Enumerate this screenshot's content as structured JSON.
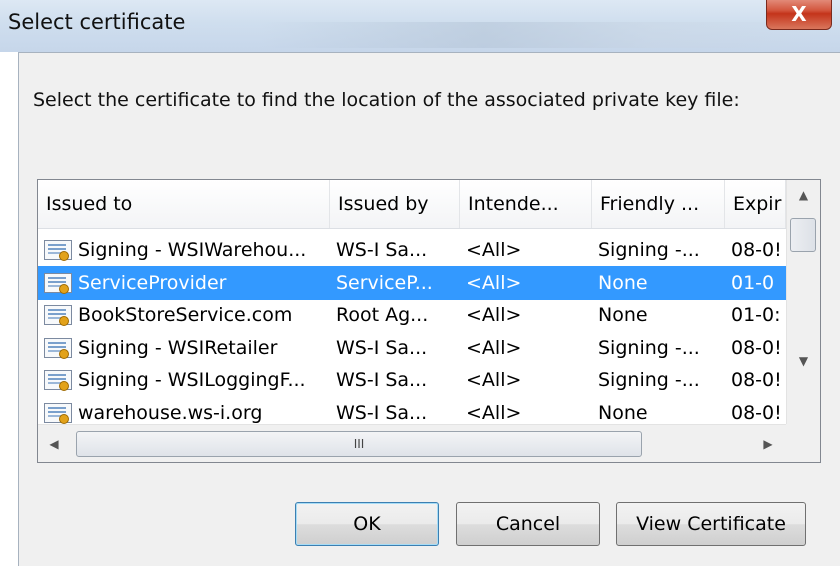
{
  "window": {
    "title": "Select certificate",
    "close_glyph": "X"
  },
  "prompt": "Select the certificate to find the location of the associated private key file:",
  "list": {
    "columns": [
      "Issued to",
      "Issued by",
      "Intende...",
      "Friendly ...",
      "Expir"
    ],
    "rows": [
      {
        "issued_to": "Signing - WSIWarehou...",
        "issued_by": "WS-I Sa...",
        "intended": "<All>",
        "friendly": "Signing -...",
        "expiry": "08-0!",
        "icon": "certificate-icon",
        "selected": false
      },
      {
        "issued_to": "ServiceProvider",
        "issued_by": "ServiceP...",
        "intended": "<All>",
        "friendly": "None",
        "expiry": "01-0",
        "icon": "certificate-icon",
        "selected": true
      },
      {
        "issued_to": "BookStoreService.com",
        "issued_by": "Root Ag...",
        "intended": "<All>",
        "friendly": "None",
        "expiry": "01-0:",
        "icon": "certificate-icon",
        "selected": false
      },
      {
        "issued_to": "Signing - WSIRetailer",
        "issued_by": "WS-I Sa...",
        "intended": "<All>",
        "friendly": "Signing -...",
        "expiry": "08-0!",
        "icon": "certificate-icon",
        "selected": false
      },
      {
        "issued_to": "Signing - WSILoggingF...",
        "issued_by": "WS-I Sa...",
        "intended": "<All>",
        "friendly": "Signing -...",
        "expiry": "08-0!",
        "icon": "certificate-icon",
        "selected": false
      },
      {
        "issued_to": "warehouse.ws-i.org",
        "issued_by": "WS-I Sa...",
        "intended": "<All>",
        "friendly": "None",
        "expiry": "08-0!",
        "icon": "certificate-icon",
        "selected": false
      }
    ],
    "hscroll_grip": "III",
    "selection_color": "#3399ff"
  },
  "buttons": {
    "ok": "OK",
    "cancel": "Cancel",
    "view_certificate": "View Certificate"
  }
}
